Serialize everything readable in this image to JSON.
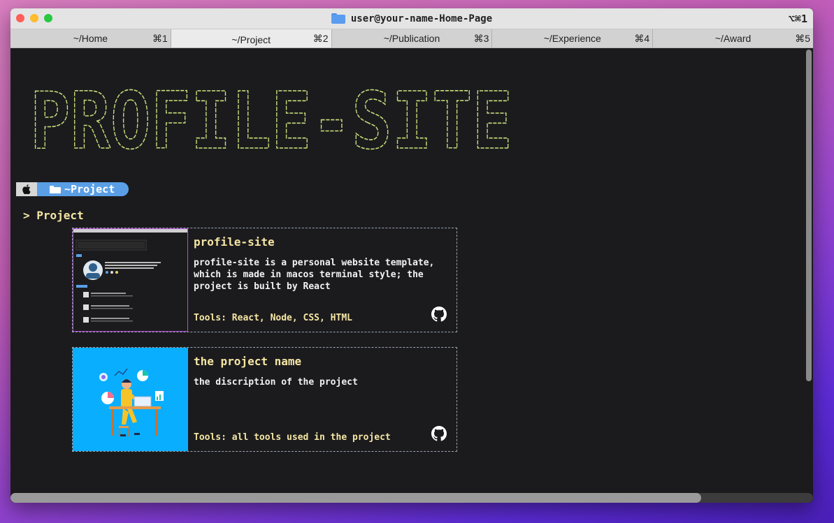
{
  "window": {
    "title": "user@your-name-Home-Page",
    "shortcut": "⌥⌘1"
  },
  "tabs": [
    {
      "label": "~/Home",
      "key": "⌘1"
    },
    {
      "label": "~/Project",
      "key": "⌘2",
      "active": true
    },
    {
      "label": "~/Publication",
      "key": "⌘3"
    },
    {
      "label": "~/Experience",
      "key": "⌘4"
    },
    {
      "label": "~/Award",
      "key": "⌘5"
    }
  ],
  "banner": {
    "text": "PROFILE-SITE"
  },
  "prompt": {
    "path": "~Project"
  },
  "section": {
    "title": "> Project"
  },
  "projects": [
    {
      "name": "profile-site",
      "description": "profile-site is a personal website template, which is made in macos terminal style; the project is built by React",
      "tools": "Tools: React, Node, CSS, HTML"
    },
    {
      "name": "the project name",
      "description": "the discription of the project",
      "tools": "Tools: all tools used in the project"
    }
  ],
  "colors": {
    "accent_yellow": "#f5e6a3",
    "prompt_blue": "#5a9fe6",
    "terminal_bg": "#1b1b1e"
  }
}
